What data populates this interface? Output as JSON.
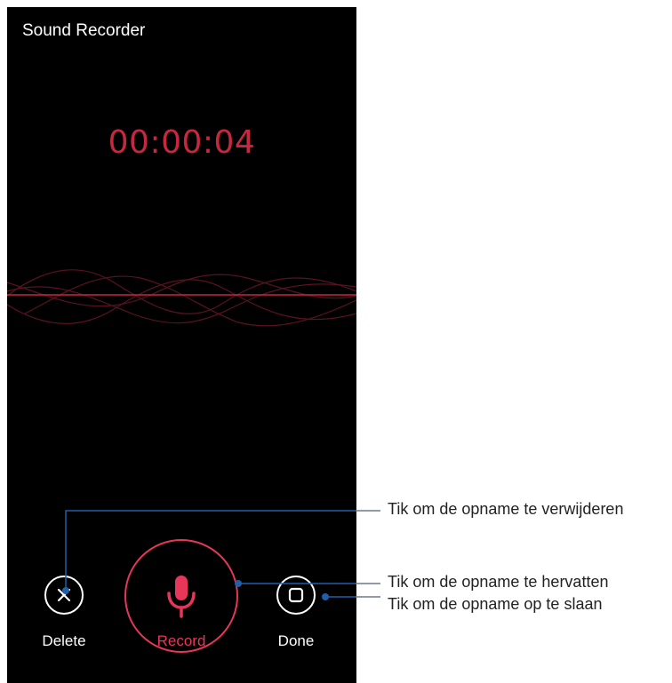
{
  "app": {
    "title": "Sound Recorder",
    "timer": "00:00:04",
    "accent_color": "#e8365a"
  },
  "controls": {
    "delete": {
      "label": "Delete",
      "icon": "close-icon"
    },
    "record": {
      "label": "Record",
      "icon": "microphone-icon"
    },
    "done": {
      "label": "Done",
      "icon": "stop-square-icon"
    }
  },
  "callouts": {
    "delete_hint": "Tik om de opname te verwijderen",
    "record_hint": "Tik om de opname te hervatten",
    "done_hint": "Tik om de opname op te slaan",
    "line_color": "#1f5fa8"
  }
}
